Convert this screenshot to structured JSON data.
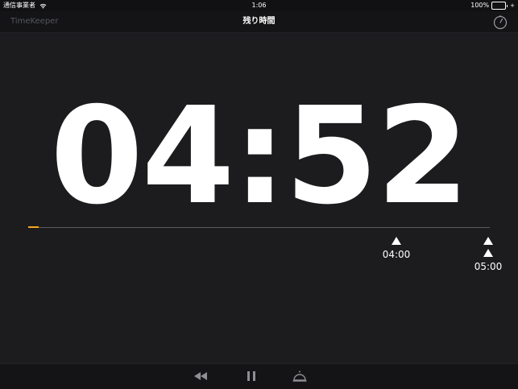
{
  "status_bar": {
    "carrier": "通信事業者",
    "time": "1:06",
    "battery_percent": "100%",
    "battery_level": 1.0,
    "battery_color": "#4cd964",
    "icons": [
      "wifi-icon",
      "battery-icon",
      "plug-icon"
    ]
  },
  "nav": {
    "app_name": "TimeKeeper",
    "title": "残り時間",
    "right_icon": "stopwatch-icon"
  },
  "timer": {
    "remaining": "04:52"
  },
  "progress": {
    "elapsed_fraction": 0.023,
    "fill_color": "#f5a623"
  },
  "markers": [
    {
      "label": "04:00"
    },
    {
      "label": "05:00"
    }
  ],
  "toolbar": {
    "icons": [
      "rewind-icon",
      "pause-icon",
      "bell-icon"
    ]
  }
}
